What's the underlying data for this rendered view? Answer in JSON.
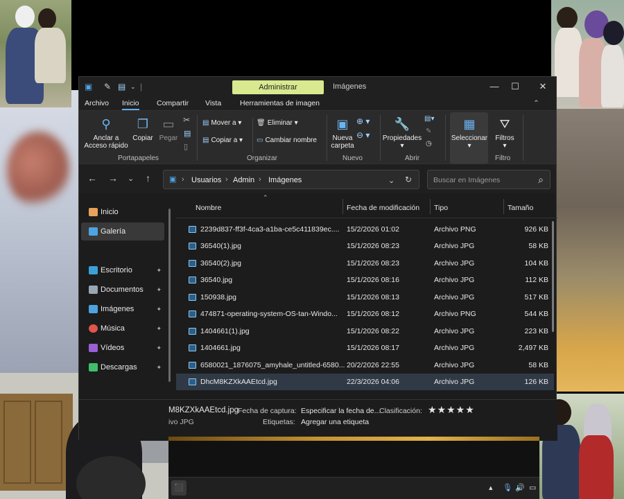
{
  "titlebar": {
    "context_tab": "Administrar",
    "context_name": "Imágenes"
  },
  "menu_tabs": [
    "Archivo",
    "Inicio",
    "Compartir",
    "Vista",
    "Herramientas de imagen"
  ],
  "ribbon": {
    "pin_label_line1": "Anclar a",
    "pin_label_line2": "Acceso rápido",
    "copy": "Copiar",
    "paste": "Pegar",
    "group_clipboard": "Portapapeles",
    "move_to": "Mover a",
    "copy_to": "Copiar a",
    "delete": "Eliminar",
    "rename": "Cambiar nombre",
    "group_organize": "Organizar",
    "new_folder_line1": "Nueva",
    "new_folder_line2": "carpeta",
    "group_new": "Nuevo",
    "properties": "Propiedades",
    "group_open": "Abrir",
    "select": "Seleccionar",
    "filters": "Filtros",
    "group_filter": "Filtro"
  },
  "address": {
    "crumbs": [
      "Usuarios",
      "Admin",
      "Imágenes"
    ],
    "search_placeholder": "Buscar en Imágenes"
  },
  "sidebar": {
    "items": [
      {
        "label": "Inicio",
        "icon": "home-icon",
        "color": "#e8a15a",
        "pinned": false
      },
      {
        "label": "Galería",
        "icon": "gallery-icon",
        "color": "#4fa3e0",
        "pinned": false,
        "selected": true
      },
      {
        "label": "Escritorio",
        "icon": "desktop-icon",
        "color": "#3ba0d8",
        "pinned": true
      },
      {
        "label": "Documentos",
        "icon": "documents-icon",
        "color": "#9aa6b2",
        "pinned": true
      },
      {
        "label": "Imágenes",
        "icon": "pictures-icon",
        "color": "#4fa3e0",
        "pinned": true
      },
      {
        "label": "Música",
        "icon": "music-icon",
        "color": "#e0564a",
        "pinned": true
      },
      {
        "label": "Vídeos",
        "icon": "videos-icon",
        "color": "#9b5fd6",
        "pinned": true
      },
      {
        "label": "Descargas",
        "icon": "downloads-icon",
        "color": "#3fbf6a",
        "pinned": true
      }
    ]
  },
  "columns": {
    "name": "Nombre",
    "modified": "Fecha de modificación",
    "type": "Tipo",
    "size": "Tamaño"
  },
  "files": [
    {
      "name": "2239d837-ff3f-4ca3-a1ba-ce5c411839ec....",
      "modified": "15/2/2026 01:02",
      "type": "Archivo PNG",
      "size": "926 KB"
    },
    {
      "name": "36540(1).jpg",
      "modified": "15/1/2026 08:23",
      "type": "Archivo JPG",
      "size": "58 KB"
    },
    {
      "name": "36540(2).jpg",
      "modified": "15/1/2026 08:23",
      "type": "Archivo JPG",
      "size": "104 KB"
    },
    {
      "name": "36540.jpg",
      "modified": "15/1/2026 08:16",
      "type": "Archivo JPG",
      "size": "112 KB"
    },
    {
      "name": "150938.jpg",
      "modified": "15/1/2026 08:13",
      "type": "Archivo JPG",
      "size": "517 KB"
    },
    {
      "name": "474871-operating-system-OS-tan-Windo...",
      "modified": "15/1/2026 08:12",
      "type": "Archivo PNG",
      "size": "544 KB"
    },
    {
      "name": "1404661(1).jpg",
      "modified": "15/1/2026 08:22",
      "type": "Archivo JPG",
      "size": "223 KB"
    },
    {
      "name": "1404661.jpg",
      "modified": "15/1/2026 08:17",
      "type": "Archivo JPG",
      "size": "2,497 KB"
    },
    {
      "name": "6580021_1876075_amyhale_untitled-6580...",
      "modified": "20/2/2026 22:55",
      "type": "Archivo JPG",
      "size": "58 KB"
    },
    {
      "name": "DhcM8KZXkAAEtcd.jpg",
      "modified": "22/3/2026 04:06",
      "type": "Archivo JPG",
      "size": "126 KB",
      "selected": true
    }
  ],
  "details": {
    "filename": "M8KZXkAAEtcd.jpg",
    "filetype": "ivo JPG",
    "capture_label": "Fecha de captura:",
    "capture_value": "Especificar la fecha de...",
    "rating_label": "Clasificación:",
    "rating_stars": "★★★★★",
    "tags_label": "Etiquetas:",
    "tags_value": "Agregar una etiqueta"
  }
}
